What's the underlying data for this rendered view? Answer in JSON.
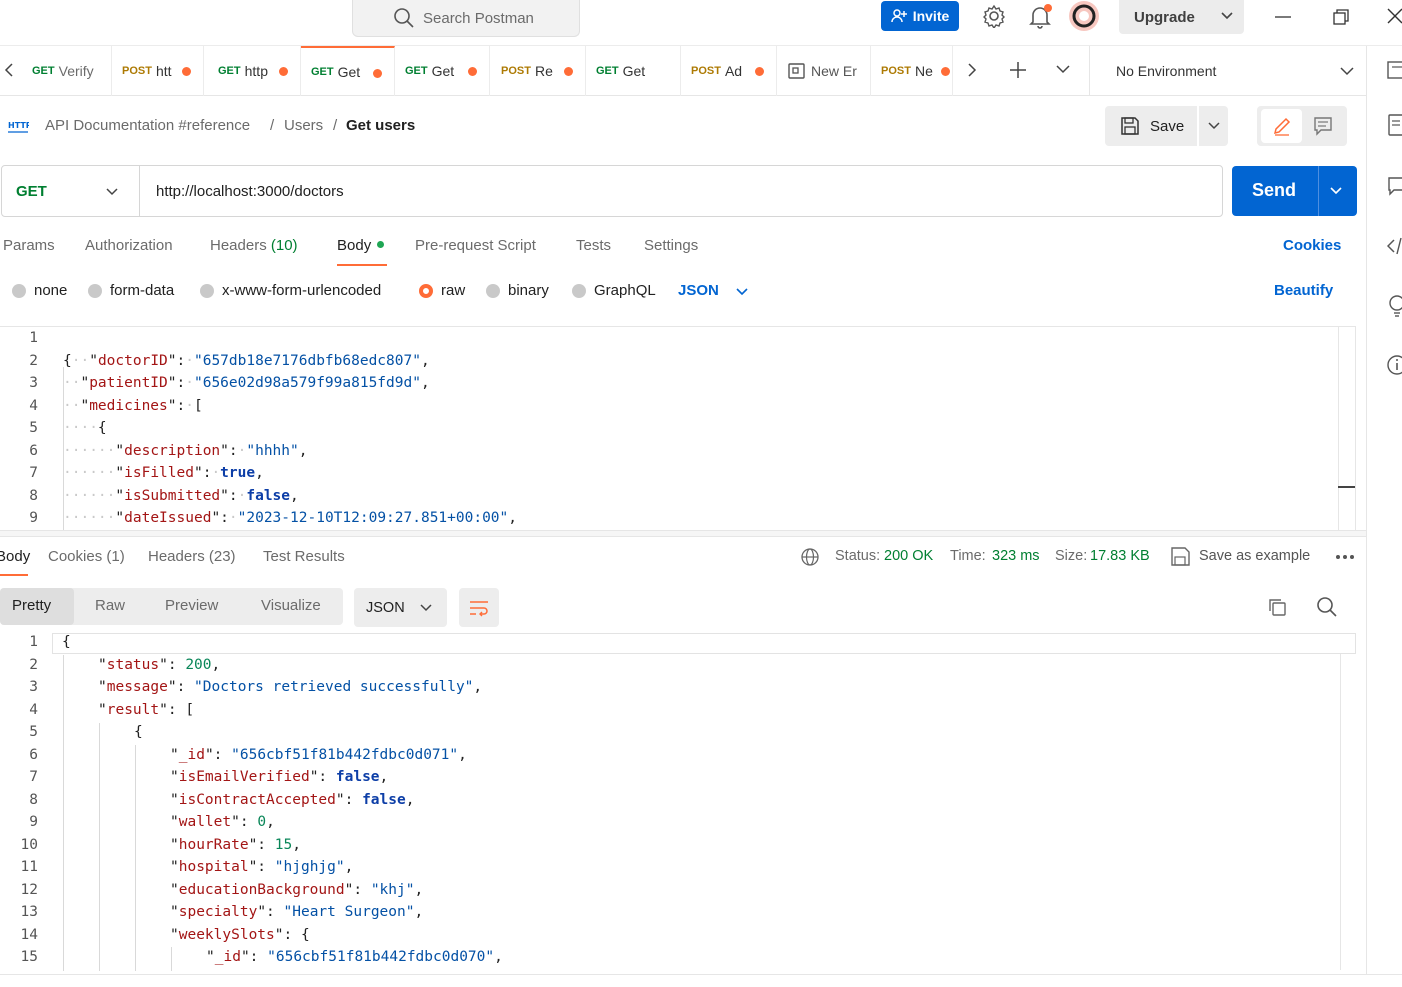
{
  "titlebar": {
    "search_placeholder": "Search Postman",
    "invite_label": "Invite",
    "upgrade_label": "Upgrade"
  },
  "tabs": [
    {
      "method": "GET",
      "name": "Verify",
      "partial": true
    },
    {
      "method": "POST",
      "name": "htt"
    },
    {
      "method": "GET",
      "name": "http"
    },
    {
      "method": "GET",
      "name": "Get",
      "active": true
    },
    {
      "method": "GET",
      "name": "Get"
    },
    {
      "method": "POST",
      "name": "Re"
    },
    {
      "method": "GET",
      "name": "Get"
    },
    {
      "method": "POST",
      "name": "Ad"
    },
    {
      "method": "",
      "name": "New Er"
    },
    {
      "method": "POST",
      "name": "Ne"
    }
  ],
  "environment": "No Environment",
  "breadcrumb": {
    "collection": "API Documentation #reference",
    "folder": "Users",
    "request": "Get users",
    "sep": "/"
  },
  "save_label": "Save",
  "request": {
    "method": "GET",
    "url": "http://localhost:3000/doctors",
    "send_label": "Send"
  },
  "request_tabs": {
    "params": "Params",
    "authorization": "Authorization",
    "headers": "Headers",
    "headers_count": "(10)",
    "body": "Body",
    "prerequest": "Pre-request Script",
    "tests": "Tests",
    "settings": "Settings",
    "cookies": "Cookies"
  },
  "body_types": {
    "none": "none",
    "form_data": "form-data",
    "urlencoded": "x-www-form-urlencoded",
    "raw": "raw",
    "binary": "binary",
    "graphql": "GraphQL",
    "format": "JSON",
    "beautify": "Beautify",
    "selected": "raw"
  },
  "request_body_lines": [
    {
      "n": "1"
    },
    {
      "n": "2",
      "key": "doctorID",
      "val": "\"657db18e7176dbfb68edc807\""
    },
    {
      "n": "3",
      "key": "patientID",
      "val": "\"656e02d98a579f99a815fd9d\""
    },
    {
      "n": "4",
      "key": "medicines",
      "val": "["
    },
    {
      "n": "5",
      "val": "{"
    },
    {
      "n": "6",
      "key": "description",
      "val": "\"hhhh\""
    },
    {
      "n": "7",
      "key": "isFilled",
      "val": "true"
    },
    {
      "n": "8",
      "key": "isSubmitted",
      "val": "false"
    },
    {
      "n": "9",
      "key": "dateIssued",
      "val": "\"2023-12-10T12:09:27.851+00:00\""
    }
  ],
  "response": {
    "tabs": {
      "body": "Body",
      "cookies": "Cookies (1)",
      "headers": "Headers (23)",
      "test_results": "Test Results"
    },
    "status_label": "Status:",
    "status_value": "200 OK",
    "time_label": "Time:",
    "time_value": "323 ms",
    "size_label": "Size:",
    "size_value": "17.83 KB",
    "save_example": "Save as example",
    "views": {
      "pretty": "Pretty",
      "raw": "Raw",
      "preview": "Preview",
      "visualize": "Visualize"
    },
    "format": "JSON"
  },
  "response_lines": [
    {
      "n": "1",
      "text": "{"
    },
    {
      "n": "2",
      "key": "status",
      "val": "200"
    },
    {
      "n": "3",
      "key": "message",
      "val": "\"Doctors retrieved successfully\""
    },
    {
      "n": "4",
      "key": "result",
      "val": "["
    },
    {
      "n": "5",
      "text": "{"
    },
    {
      "n": "6",
      "key": "_id",
      "val": "\"656cbf51f81b442fdbc0d071\""
    },
    {
      "n": "7",
      "key": "isEmailVerified",
      "val": "false"
    },
    {
      "n": "8",
      "key": "isContractAccepted",
      "val": "false"
    },
    {
      "n": "9",
      "key": "wallet",
      "val": "0"
    },
    {
      "n": "10",
      "key": "hourRate",
      "val": "15"
    },
    {
      "n": "11",
      "key": "hospital",
      "val": "\"hjghjg\""
    },
    {
      "n": "12",
      "key": "educationBackground",
      "val": "\"khj\""
    },
    {
      "n": "13",
      "key": "specialty",
      "val": "\"Heart Surgeon\""
    },
    {
      "n": "14",
      "key": "weeklySlots",
      "val": "{"
    },
    {
      "n": "15",
      "key": "_id",
      "val": "\"656cbf51f81b442fdbc0d070\""
    }
  ],
  "colors": {
    "accent": "#ff6c37",
    "primary": "#0265d2",
    "get": "#007f31",
    "post": "#ad7a03"
  }
}
